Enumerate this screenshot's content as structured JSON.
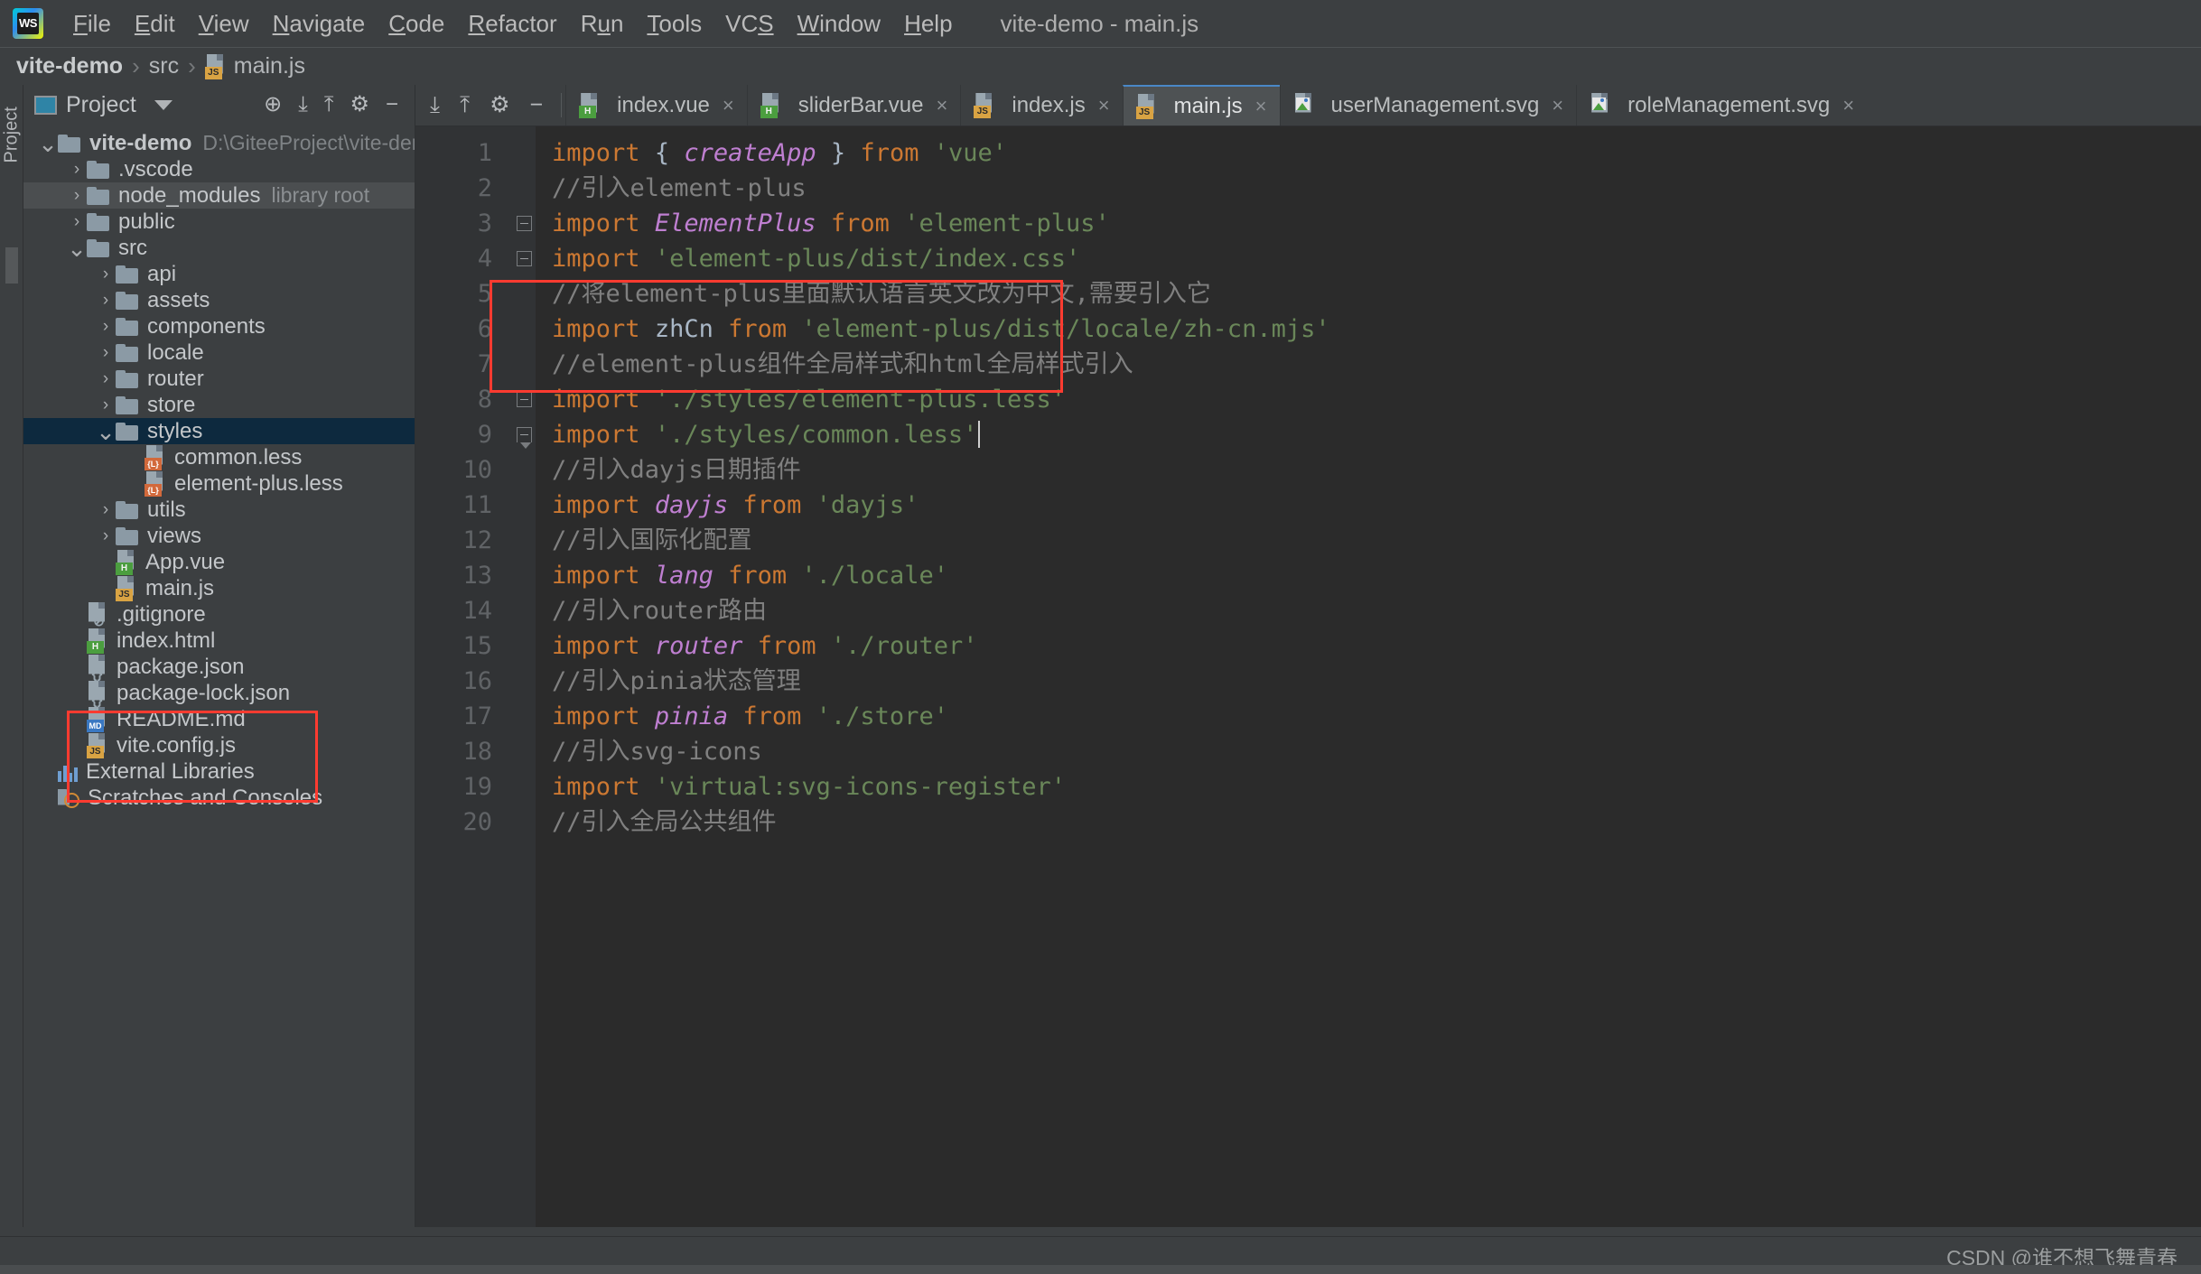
{
  "window": {
    "title": "vite-demo - main.js",
    "logo_text": "WS"
  },
  "menubar": {
    "items": [
      {
        "label": "File",
        "mnemonic": "F"
      },
      {
        "label": "Edit",
        "mnemonic": "E"
      },
      {
        "label": "View",
        "mnemonic": "V"
      },
      {
        "label": "Navigate",
        "mnemonic": "N"
      },
      {
        "label": "Code",
        "mnemonic": "C"
      },
      {
        "label": "Refactor",
        "mnemonic": "R"
      },
      {
        "label": "Run",
        "mnemonic": "u"
      },
      {
        "label": "Tools",
        "mnemonic": "T"
      },
      {
        "label": "VCS",
        "mnemonic": "S"
      },
      {
        "label": "Window",
        "mnemonic": "W"
      },
      {
        "label": "Help",
        "mnemonic": "H"
      }
    ]
  },
  "breadcrumb": {
    "items": [
      {
        "label": "vite-demo",
        "bold": true,
        "icon": ""
      },
      {
        "label": "src",
        "bold": false,
        "icon": ""
      },
      {
        "label": "main.js",
        "bold": false,
        "icon": "js-file-icon"
      }
    ],
    "separator": "›"
  },
  "toolwindow_strip": {
    "label": "Project"
  },
  "project_panel": {
    "title": "Project",
    "dropdown_caret": "▼",
    "actions": [
      {
        "name": "locate-icon",
        "glyph": "⊕"
      },
      {
        "name": "expand-all-icon",
        "glyph": "⤓"
      },
      {
        "name": "collapse-all-icon",
        "glyph": "⤒"
      },
      {
        "name": "settings-gear-icon",
        "glyph": "⚙"
      },
      {
        "name": "hide-panel-icon",
        "glyph": "−"
      }
    ],
    "tree": [
      {
        "label": "vite-demo",
        "sub": "D:\\GiteeProject\\vite-demo",
        "indent": 0,
        "arrow": "⌄",
        "type": "folder",
        "bold": true,
        "selected": false
      },
      {
        "label": ".vscode",
        "sub": "",
        "indent": 1,
        "arrow": "›",
        "type": "folder",
        "bold": false,
        "selected": false
      },
      {
        "label": "node_modules",
        "sub": "library root",
        "indent": 1,
        "arrow": "›",
        "type": "folder",
        "bold": false,
        "selected": false,
        "hover": true
      },
      {
        "label": "public",
        "sub": "",
        "indent": 1,
        "arrow": "›",
        "type": "folder",
        "bold": false,
        "selected": false
      },
      {
        "label": "src",
        "sub": "",
        "indent": 1,
        "arrow": "⌄",
        "type": "folder",
        "bold": false,
        "selected": false
      },
      {
        "label": "api",
        "sub": "",
        "indent": 2,
        "arrow": "›",
        "type": "folder",
        "bold": false,
        "selected": false
      },
      {
        "label": "assets",
        "sub": "",
        "indent": 2,
        "arrow": "›",
        "type": "folder",
        "bold": false,
        "selected": false
      },
      {
        "label": "components",
        "sub": "",
        "indent": 2,
        "arrow": "›",
        "type": "folder",
        "bold": false,
        "selected": false
      },
      {
        "label": "locale",
        "sub": "",
        "indent": 2,
        "arrow": "›",
        "type": "folder",
        "bold": false,
        "selected": false
      },
      {
        "label": "router",
        "sub": "",
        "indent": 2,
        "arrow": "›",
        "type": "folder",
        "bold": false,
        "selected": false
      },
      {
        "label": "store",
        "sub": "",
        "indent": 2,
        "arrow": "›",
        "type": "folder",
        "bold": false,
        "selected": false
      },
      {
        "label": "styles",
        "sub": "",
        "indent": 2,
        "arrow": "⌄",
        "type": "folder",
        "bold": false,
        "selected": true
      },
      {
        "label": "common.less",
        "sub": "",
        "indent": 3,
        "arrow": "",
        "type": "less",
        "bold": false,
        "selected": false
      },
      {
        "label": "element-plus.less",
        "sub": "",
        "indent": 3,
        "arrow": "",
        "type": "less",
        "bold": false,
        "selected": false
      },
      {
        "label": "utils",
        "sub": "",
        "indent": 2,
        "arrow": "›",
        "type": "folder",
        "bold": false,
        "selected": false
      },
      {
        "label": "views",
        "sub": "",
        "indent": 2,
        "arrow": "›",
        "type": "folder",
        "bold": false,
        "selected": false
      },
      {
        "label": "App.vue",
        "sub": "",
        "indent": 2,
        "arrow": "",
        "type": "vue",
        "bold": false,
        "selected": false
      },
      {
        "label": "main.js",
        "sub": "",
        "indent": 2,
        "arrow": "",
        "type": "js",
        "bold": false,
        "selected": false
      },
      {
        "label": ".gitignore",
        "sub": "",
        "indent": 1,
        "arrow": "",
        "type": "gitignore",
        "bold": false,
        "selected": false
      },
      {
        "label": "index.html",
        "sub": "",
        "indent": 1,
        "arrow": "",
        "type": "vue",
        "bold": false,
        "selected": false
      },
      {
        "label": "package.json",
        "sub": "",
        "indent": 1,
        "arrow": "",
        "type": "json",
        "bold": false,
        "selected": false
      },
      {
        "label": "package-lock.json",
        "sub": "",
        "indent": 1,
        "arrow": "",
        "type": "json",
        "bold": false,
        "selected": false
      },
      {
        "label": "README.md",
        "sub": "",
        "indent": 1,
        "arrow": "",
        "type": "md",
        "bold": false,
        "selected": false
      },
      {
        "label": "vite.config.js",
        "sub": "",
        "indent": 1,
        "arrow": "",
        "type": "js",
        "bold": false,
        "selected": false
      },
      {
        "label": "External Libraries",
        "sub": "",
        "indent": 0,
        "arrow": "",
        "type": "extlib",
        "bold": false,
        "selected": false
      },
      {
        "label": "Scratches and Consoles",
        "sub": "",
        "indent": 0,
        "arrow": "",
        "type": "scratch",
        "bold": false,
        "selected": false
      }
    ]
  },
  "editor_tabs": {
    "tools": [
      {
        "name": "expand-all-icon",
        "glyph": "⤓"
      },
      {
        "name": "collapse-all-icon",
        "glyph": "⤒"
      },
      {
        "name": "settings-gear-icon",
        "glyph": "⚙"
      },
      {
        "name": "hide-panel-icon",
        "glyph": "−"
      }
    ],
    "tabs": [
      {
        "label": "index.vue",
        "type": "vue",
        "active": false
      },
      {
        "label": "sliderBar.vue",
        "type": "vue",
        "active": false
      },
      {
        "label": "index.js",
        "type": "js",
        "active": false
      },
      {
        "label": "main.js",
        "type": "js",
        "active": true
      },
      {
        "label": "userManagement.svg",
        "type": "svg",
        "active": false
      },
      {
        "label": "roleManagement.svg",
        "type": "svg",
        "active": false
      }
    ],
    "close_glyph": "×"
  },
  "code": {
    "lines": [
      {
        "n": "1",
        "fold": "",
        "tokens": [
          {
            "t": "import",
            "c": "kw"
          },
          {
            "t": " ",
            "c": "pl"
          },
          {
            "t": "{",
            "c": "brc"
          },
          {
            "t": " ",
            "c": "pl"
          },
          {
            "t": "createApp",
            "c": "cls"
          },
          {
            "t": " ",
            "c": "pl"
          },
          {
            "t": "}",
            "c": "brc"
          },
          {
            "t": " ",
            "c": "pl"
          },
          {
            "t": "from",
            "c": "kw"
          },
          {
            "t": " ",
            "c": "pl"
          },
          {
            "t": "'vue'",
            "c": "str"
          }
        ]
      },
      {
        "n": "2",
        "fold": "",
        "tokens": [
          {
            "t": "//引入element-plus",
            "c": "cm"
          }
        ]
      },
      {
        "n": "3",
        "fold": "minus",
        "tokens": [
          {
            "t": "import",
            "c": "kw"
          },
          {
            "t": " ",
            "c": "pl"
          },
          {
            "t": "ElementPlus",
            "c": "cls"
          },
          {
            "t": " ",
            "c": "pl"
          },
          {
            "t": "from",
            "c": "kw"
          },
          {
            "t": " ",
            "c": "pl"
          },
          {
            "t": "'element-plus'",
            "c": "str"
          }
        ]
      },
      {
        "n": "4",
        "fold": "minus",
        "tokens": [
          {
            "t": "import",
            "c": "kw"
          },
          {
            "t": " ",
            "c": "pl"
          },
          {
            "t": "'element-plus/dist/index.css'",
            "c": "str"
          }
        ]
      },
      {
        "n": "5",
        "fold": "",
        "tokens": [
          {
            "t": "//将element-plus里面默认语言英文改为中文,需要引入它",
            "c": "cm"
          }
        ]
      },
      {
        "n": "6",
        "fold": "",
        "tokens": [
          {
            "t": "import",
            "c": "kw"
          },
          {
            "t": " ",
            "c": "pl"
          },
          {
            "t": "zhCn",
            "c": "pl"
          },
          {
            "t": " ",
            "c": "pl"
          },
          {
            "t": "from",
            "c": "kw"
          },
          {
            "t": " ",
            "c": "pl"
          },
          {
            "t": "'element-plus/dist/locale/zh-cn.mjs'",
            "c": "str"
          }
        ]
      },
      {
        "n": "7",
        "fold": "",
        "tokens": [
          {
            "t": "//element-plus组件全局样式和html全局样式引入",
            "c": "cm"
          }
        ]
      },
      {
        "n": "8",
        "fold": "minus",
        "tokens": [
          {
            "t": "import",
            "c": "kw"
          },
          {
            "t": " ",
            "c": "pl"
          },
          {
            "t": "'./styles/element-plus.less'",
            "c": "str"
          }
        ]
      },
      {
        "n": "9",
        "fold": "arrowdown",
        "tokens": [
          {
            "t": "import",
            "c": "kw"
          },
          {
            "t": " ",
            "c": "pl"
          },
          {
            "t": "'./styles/common.less'",
            "c": "str"
          },
          {
            "t": "|caret|",
            "c": "caret"
          }
        ]
      },
      {
        "n": "10",
        "fold": "",
        "tokens": [
          {
            "t": "//引入dayjs日期插件",
            "c": "cm"
          }
        ]
      },
      {
        "n": "11",
        "fold": "",
        "tokens": [
          {
            "t": "import",
            "c": "kw"
          },
          {
            "t": " ",
            "c": "pl"
          },
          {
            "t": "dayjs",
            "c": "cls"
          },
          {
            "t": " ",
            "c": "pl"
          },
          {
            "t": "from",
            "c": "kw"
          },
          {
            "t": " ",
            "c": "pl"
          },
          {
            "t": "'dayjs'",
            "c": "str"
          }
        ]
      },
      {
        "n": "12",
        "fold": "",
        "tokens": [
          {
            "t": "//引入国际化配置",
            "c": "cm"
          }
        ]
      },
      {
        "n": "13",
        "fold": "",
        "tokens": [
          {
            "t": "import",
            "c": "kw"
          },
          {
            "t": " ",
            "c": "pl"
          },
          {
            "t": "lang",
            "c": "cls"
          },
          {
            "t": " ",
            "c": "pl"
          },
          {
            "t": "from",
            "c": "kw"
          },
          {
            "t": " ",
            "c": "pl"
          },
          {
            "t": "'./locale'",
            "c": "str"
          }
        ]
      },
      {
        "n": "14",
        "fold": "",
        "tokens": [
          {
            "t": "//引入router路由",
            "c": "cm"
          }
        ]
      },
      {
        "n": "15",
        "fold": "",
        "tokens": [
          {
            "t": "import",
            "c": "kw"
          },
          {
            "t": " ",
            "c": "pl"
          },
          {
            "t": "router",
            "c": "cls"
          },
          {
            "t": " ",
            "c": "pl"
          },
          {
            "t": "from",
            "c": "kw"
          },
          {
            "t": " ",
            "c": "pl"
          },
          {
            "t": "'./router'",
            "c": "str"
          }
        ]
      },
      {
        "n": "16",
        "fold": "",
        "tokens": [
          {
            "t": "//引入pinia状态管理",
            "c": "cm"
          }
        ]
      },
      {
        "n": "17",
        "fold": "",
        "tokens": [
          {
            "t": "import",
            "c": "kw"
          },
          {
            "t": " ",
            "c": "pl"
          },
          {
            "t": "pinia",
            "c": "cls"
          },
          {
            "t": " ",
            "c": "pl"
          },
          {
            "t": "from",
            "c": "kw"
          },
          {
            "t": " ",
            "c": "pl"
          },
          {
            "t": "'./store'",
            "c": "str"
          }
        ]
      },
      {
        "n": "18",
        "fold": "",
        "tokens": [
          {
            "t": "//引入svg-icons",
            "c": "cm"
          }
        ]
      },
      {
        "n": "19",
        "fold": "",
        "tokens": [
          {
            "t": "import",
            "c": "kw"
          },
          {
            "t": " ",
            "c": "pl"
          },
          {
            "t": "'virtual:svg-icons-register'",
            "c": "str"
          }
        ]
      },
      {
        "n": "20",
        "fold": "",
        "tokens": [
          {
            "t": "//引入全局公共组件",
            "c": "cm"
          }
        ]
      }
    ]
  },
  "annotations": {
    "highlight_color": "#ff3b30",
    "boxes": [
      {
        "name": "styles-folder-highlight"
      },
      {
        "name": "styles-import-lines-highlight"
      }
    ]
  },
  "watermark": {
    "text": "CSDN @谁不想飞舞青春"
  },
  "colors": {
    "background": "#3c3f41",
    "editor_background": "#2b2b2b",
    "gutter": "#313335",
    "selection": "#0d293e",
    "accent": "#4a88c7",
    "keyword": "#cc7832",
    "string": "#6a8759",
    "comment": "#808080",
    "class_name": "#bf7fd1",
    "plain": "#a9b7c6"
  }
}
